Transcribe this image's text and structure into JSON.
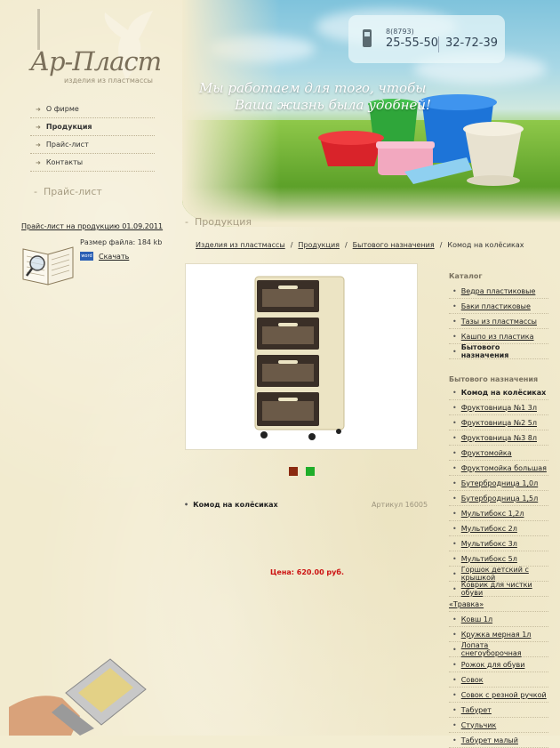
{
  "brand": {
    "logo": "Ар-Пласт",
    "tagline": "изделия из пластмассы"
  },
  "header": {
    "slogan_line1": "Мы работаем для того, чтобы",
    "slogan_line2": "Ваша жизнь была удобней!",
    "phone_code": "8(8793)",
    "phone1": "25-55-50",
    "phone2": "32-72-39"
  },
  "nav": {
    "items": [
      {
        "label": "О фирме",
        "active": false
      },
      {
        "label": "Продукция",
        "active": true
      },
      {
        "label": "Прайс-лист",
        "active": false
      },
      {
        "label": "Контакты",
        "active": false
      }
    ]
  },
  "pricelist": {
    "section_title": "Прайс-лист",
    "link": "Прайс-лист на продукцию 01.09.2011",
    "file_size": "Размер файла: 184 kb",
    "word_badge": "word",
    "download": "Скачать"
  },
  "main": {
    "section_title": "Продукция",
    "breadcrumb": [
      "Изделия из пластмассы",
      "Продукция",
      "Бытового назначения",
      "Комод на колёсиках"
    ],
    "product_name": "Комод на колёсиках",
    "article": "Артикул 16005",
    "price": "Цена: 620.00 руб.",
    "color_swatches": [
      "#8b2a10",
      "#1fae2a"
    ]
  },
  "sidebar": {
    "catalog_title": "Каталог",
    "catalog": [
      "Ведра пластиковые",
      "Баки пластиковые",
      "Тазы из пластмассы",
      "Кашпо из пластика",
      "Бытового назначения"
    ],
    "catalog_current": 4,
    "sub_title": "Бытового назначения",
    "sub": [
      "Комод на колёсиках",
      "Фруктовница №1 3л",
      "Фруктовница №2 5л",
      "Фруктовница №3 8л",
      "Фруктомойка",
      "Фруктомойка большая",
      "Бутербродница 1,0л",
      "Бутербродница 1,5л",
      "Мультибокс 1,2л",
      "Мультибокс 2л",
      "Мультибокс 3л",
      "Мультибокс 5л",
      "Горшок детский с крышкой",
      "Коврик для чистки обуви"
    ],
    "orphan": "«Травка»",
    "sub2": [
      "Ковш 1л",
      "Кружка мерная 1л",
      "Лопата снегоуборочная",
      "Рожок для обуви",
      "Совок",
      "Совок с резной ручкой",
      "Табурет",
      "Стульчик",
      "Табурет малый"
    ]
  }
}
